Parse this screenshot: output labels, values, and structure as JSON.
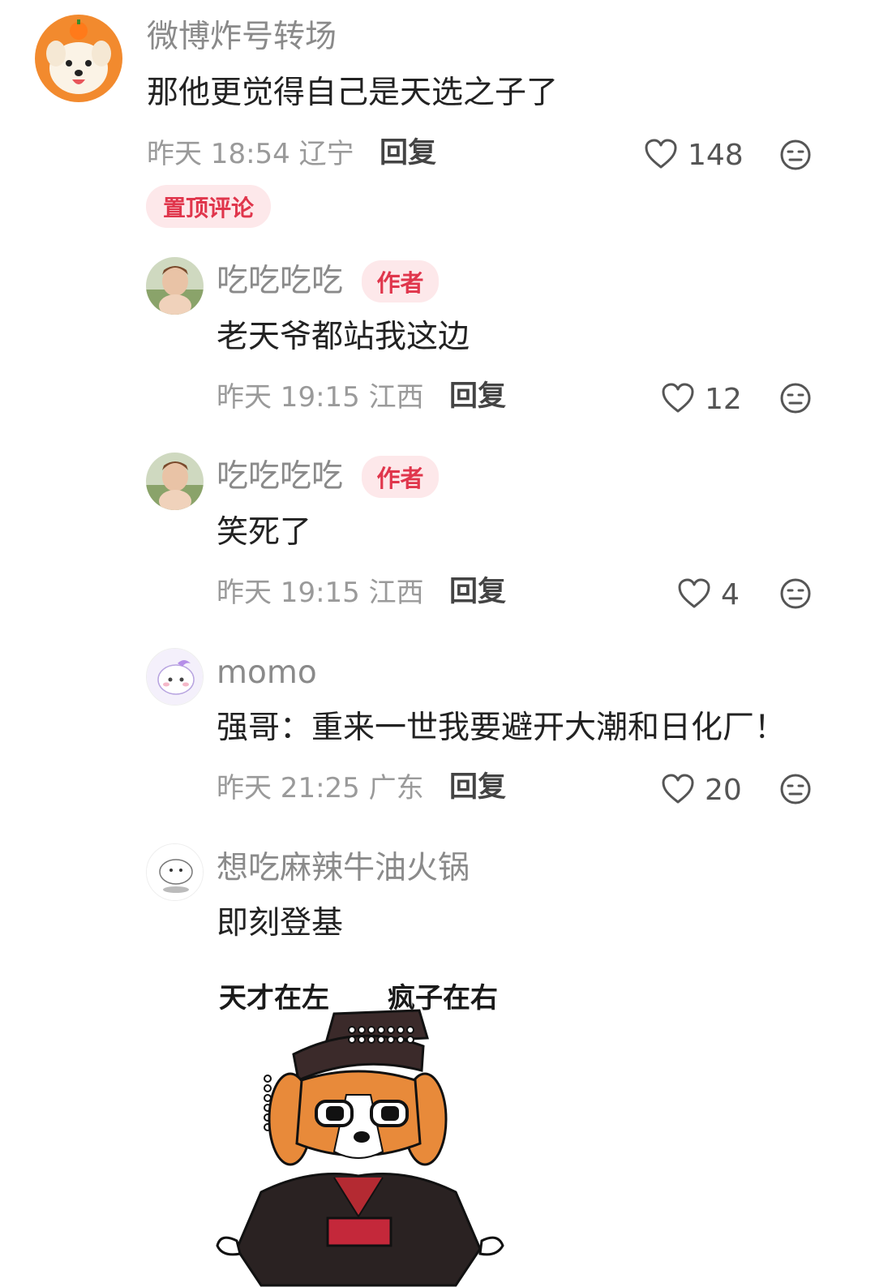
{
  "comments": [
    {
      "username": "微博炸号转场",
      "text": "那他更觉得自己是天选之子了",
      "time": "昨天 18:54",
      "location": "辽宁",
      "reply_label": "回复",
      "likes": "148",
      "pinned_label": "置顶评论"
    },
    {
      "username": "吃吃吃吃",
      "badge": "作者",
      "text": "老天爷都站我这边",
      "time": "昨天 19:15",
      "location": "江西",
      "reply_label": "回复",
      "likes": "12"
    },
    {
      "username": "吃吃吃吃",
      "badge": "作者",
      "text": "笑死了",
      "time": "昨天 19:15",
      "location": "江西",
      "reply_label": "回复",
      "likes": "4"
    },
    {
      "username": "momo",
      "text": "强哥：重来一世我要避开大潮和日化厂！",
      "time": "昨天 21:25",
      "location": "广东",
      "reply_label": "回复",
      "likes": "20"
    },
    {
      "username": "想吃麻辣牛油火锅",
      "text": "即刻登基",
      "sticker": {
        "left_caption": "天才在左",
        "right_caption": "疯子在右"
      }
    }
  ],
  "colors": {
    "badge_bg": "#fde8ea",
    "badge_text": "#e0364c",
    "meta_text": "#9a9a9a",
    "content_text": "#222222"
  },
  "icons": [
    "heart-icon",
    "dislike-face-icon"
  ]
}
